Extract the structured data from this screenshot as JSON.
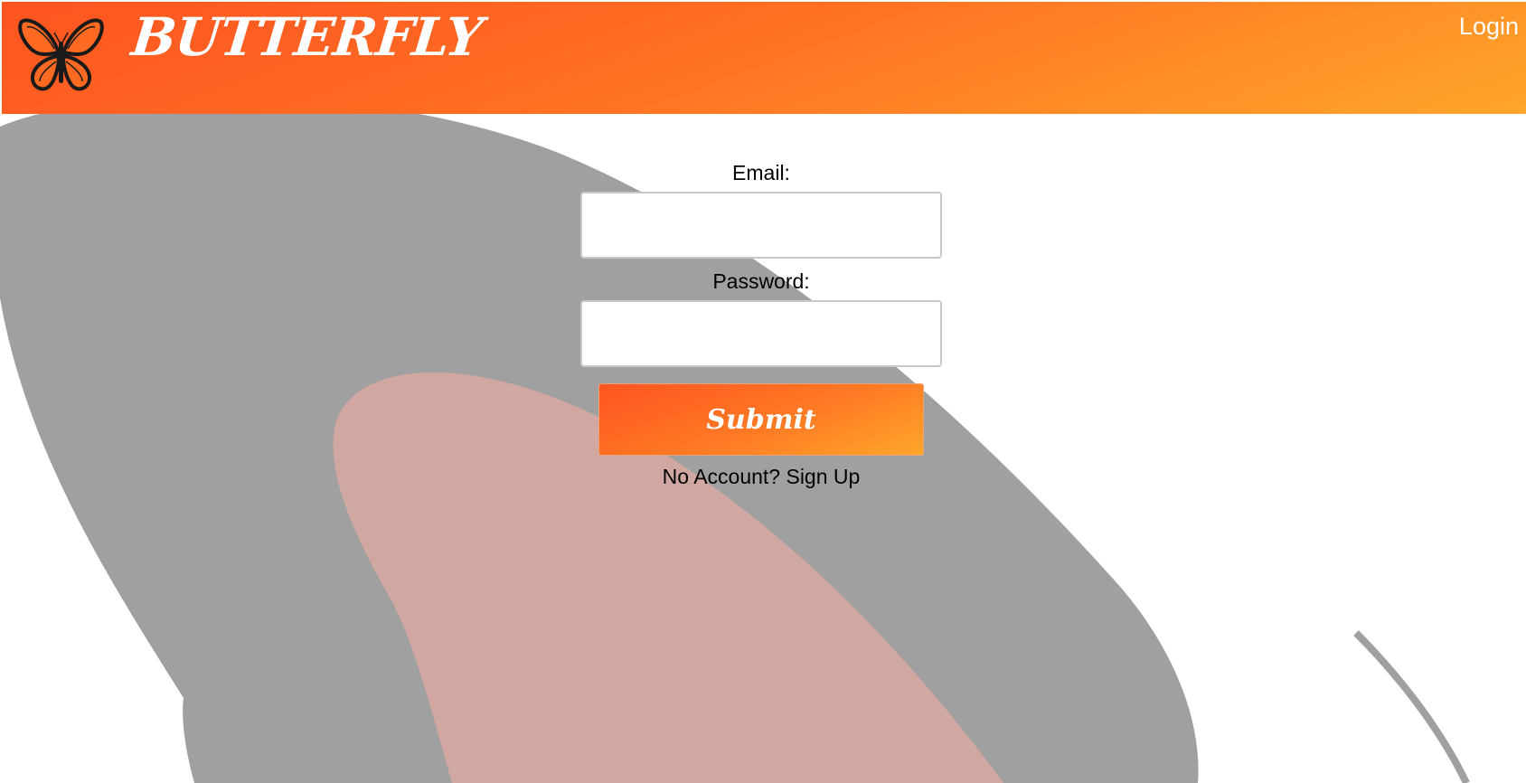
{
  "header": {
    "brand": "BUTTERFLY",
    "logo_icon": "butterfly-icon",
    "login_link": "Login",
    "gradient_start": "#ff5421",
    "gradient_end": "#ffa62b"
  },
  "form": {
    "email_label": "Email:",
    "email_value": "",
    "password_label": "Password:",
    "password_value": "",
    "submit_label": "Submit",
    "signup_link": "No Account? Sign Up"
  },
  "background": {
    "shape_colors": [
      "#a0a0a0",
      "#d1a7a1"
    ]
  }
}
